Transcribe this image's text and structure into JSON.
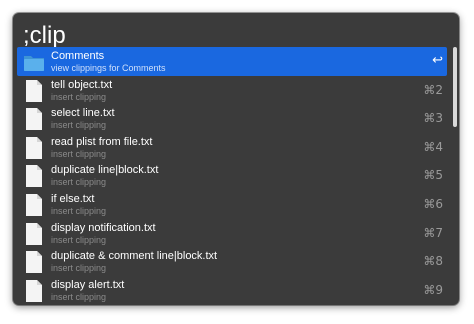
{
  "search": {
    "query": ";clip"
  },
  "results": [
    {
      "title": "Comments",
      "subtitle": "view clippings for Comments",
      "shortcut": "↩",
      "icon": "folder-icon",
      "selected": true
    },
    {
      "title": "tell object.txt",
      "subtitle": "insert clipping",
      "shortcut": "⌘2",
      "icon": "document-icon"
    },
    {
      "title": "select line.txt",
      "subtitle": "insert clipping",
      "shortcut": "⌘3",
      "icon": "document-icon"
    },
    {
      "title": "read plist from file.txt",
      "subtitle": "insert clipping",
      "shortcut": "⌘4",
      "icon": "document-icon"
    },
    {
      "title": "duplicate line|block.txt",
      "subtitle": "insert clipping",
      "shortcut": "⌘5",
      "icon": "document-icon"
    },
    {
      "title": "if else.txt",
      "subtitle": "insert clipping",
      "shortcut": "⌘6",
      "icon": "document-icon"
    },
    {
      "title": "display notification.txt",
      "subtitle": "insert clipping",
      "shortcut": "⌘7",
      "icon": "document-icon"
    },
    {
      "title": "duplicate & comment line|block.txt",
      "subtitle": "insert clipping",
      "shortcut": "⌘8",
      "icon": "document-icon"
    },
    {
      "title": "display alert.txt",
      "subtitle": "insert clipping",
      "shortcut": "⌘9",
      "icon": "document-icon"
    }
  ],
  "colors": {
    "background": "#3b3b3b",
    "selection": "#1a68e0",
    "folder": "#5ab0ec",
    "title": "#ffffff",
    "subtitle": "#8a8a8a"
  }
}
